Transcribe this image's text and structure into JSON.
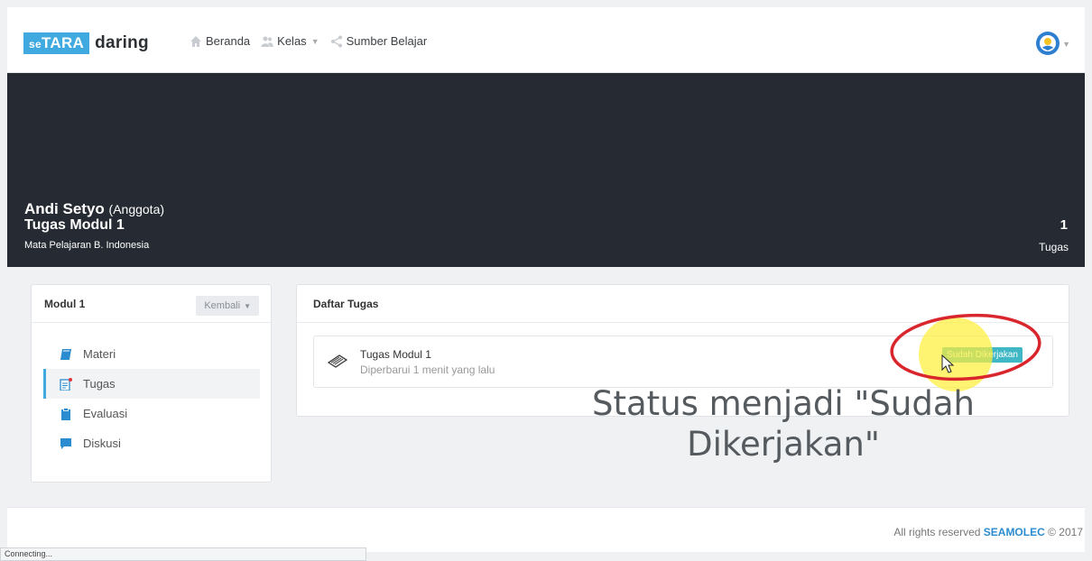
{
  "brand": {
    "logo_prefix": "se",
    "logo_main": "TARA",
    "logo_suffix": "daring"
  },
  "nav": {
    "items": [
      {
        "label": "Beranda",
        "icon": "home-icon"
      },
      {
        "label": "Kelas",
        "icon": "users-icon",
        "has_dropdown": true
      },
      {
        "label": "Sumber Belajar",
        "icon": "share-icon"
      }
    ]
  },
  "hero": {
    "name": "Andi Setyo",
    "role": "(Anggota)",
    "title": "Tugas Modul 1",
    "subject": "Mata Pelajaran B. Indonesia",
    "count": "1",
    "count_label": "Tugas"
  },
  "sidebar": {
    "title": "Modul 1",
    "back_label": "Kembali",
    "items": [
      {
        "label": "Materi",
        "icon": "book-icon"
      },
      {
        "label": "Tugas",
        "icon": "document-icon",
        "active": true
      },
      {
        "label": "Evaluasi",
        "icon": "clipboard-icon"
      },
      {
        "label": "Diskusi",
        "icon": "chat-icon"
      }
    ]
  },
  "content": {
    "title": "Daftar Tugas",
    "tasks": [
      {
        "title": "Tugas Modul 1",
        "updated": "Diperbarui 1 menit yang lalu",
        "status": "Sudah Dikerjakan"
      }
    ]
  },
  "annotation": {
    "caption_line1": "Status menjadi \"Sudah",
    "caption_line2": "Dikerjakan\""
  },
  "footer": {
    "prefix": "All rights reserved",
    "brand": "SEAMOLEC",
    "suffix": "© 2017"
  },
  "statusbar": {
    "text": "Connecting..."
  },
  "colors": {
    "accent": "#3fa9e0",
    "hero_bg": "#262b33",
    "status_badge": "#3fb7c4",
    "annotation_ring": "#d9262c",
    "highlight": "#ffee3c"
  }
}
